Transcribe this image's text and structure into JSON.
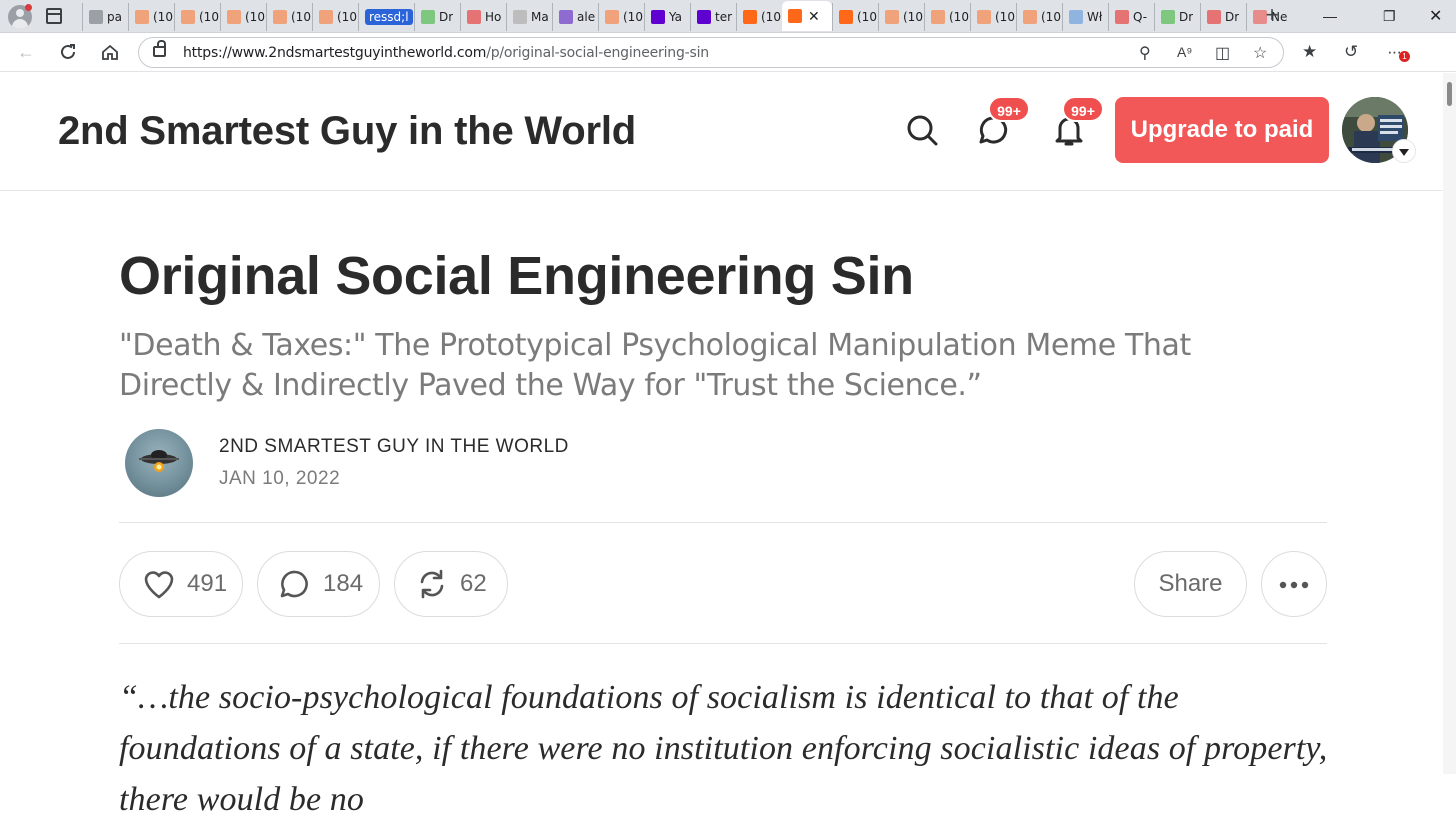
{
  "browser": {
    "tabs": [
      {
        "label": "pa",
        "fav": "#9aa0a6"
      },
      {
        "label": "(10",
        "fav": "#f0a27a"
      },
      {
        "label": "(10",
        "fav": "#f0a27a"
      },
      {
        "label": "(10",
        "fav": "#f0a27a"
      },
      {
        "label": "(10",
        "fav": "#f0a27a"
      },
      {
        "label": "(10",
        "fav": "#f0a27a"
      },
      {
        "label": "ressd;l",
        "fav": "",
        "highlight": true
      },
      {
        "label": "Dr",
        "fav": "#7ec77e"
      },
      {
        "label": "Ho",
        "fav": "#e57373"
      },
      {
        "label": "Ma",
        "fav": "#bdbdbd"
      },
      {
        "label": "ale",
        "fav": "#8e6bd1"
      },
      {
        "label": "(10",
        "fav": "#f0a27a"
      },
      {
        "label": "Ya",
        "fav": "#5f01d1"
      },
      {
        "label": "ter",
        "fav": "#5f01d1"
      },
      {
        "label": "(10",
        "fav": "#ff6719"
      },
      {
        "label": "",
        "fav": "#ff6719",
        "active": true
      },
      {
        "label": "(10",
        "fav": "#ff6719"
      },
      {
        "label": "(10",
        "fav": "#f0a27a"
      },
      {
        "label": "(10",
        "fav": "#f0a27a"
      },
      {
        "label": "(10",
        "fav": "#f0a27a"
      },
      {
        "label": "(10",
        "fav": "#f0a27a"
      },
      {
        "label": "Wł",
        "fav": "#90b4e0"
      },
      {
        "label": "Q-",
        "fav": "#e57373"
      },
      {
        "label": "Dr",
        "fav": "#7ec77e"
      },
      {
        "label": "Dr",
        "fav": "#e57373"
      },
      {
        "label": "Ne",
        "fav": "#e88b8b"
      }
    ],
    "url_host": "https://www.2ndsmartestguyintheworld.com",
    "url_path": "/p/original-social-engineering-sin",
    "notification_badge": "1"
  },
  "header": {
    "site_title": "2nd Smartest Guy in the World",
    "chat_badge": "99+",
    "bell_badge": "99+",
    "upgrade_label": "Upgrade to paid"
  },
  "post": {
    "title": "Original Social Engineering Sin",
    "subtitle": "\"Death & Taxes:\" The Prototypical Psychological Manipulation Meme That Directly & Indirectly Paved the Way for \"Trust the Science.”",
    "author": "2ND SMARTEST GUY IN THE WORLD",
    "date": "JAN 10, 2022",
    "likes": "491",
    "comments": "184",
    "restacks": "62",
    "share_label": "Share",
    "quote": "“…the socio-psychological foundations of socialism is identical to that of the foundations of a state, if there were no institution enforcing socialistic ideas of property, there would be no"
  },
  "colors": {
    "accent": "#f25858",
    "badge": "#ef4f4f",
    "text": "#2b2b2b",
    "muted": "#7b7b7b"
  }
}
